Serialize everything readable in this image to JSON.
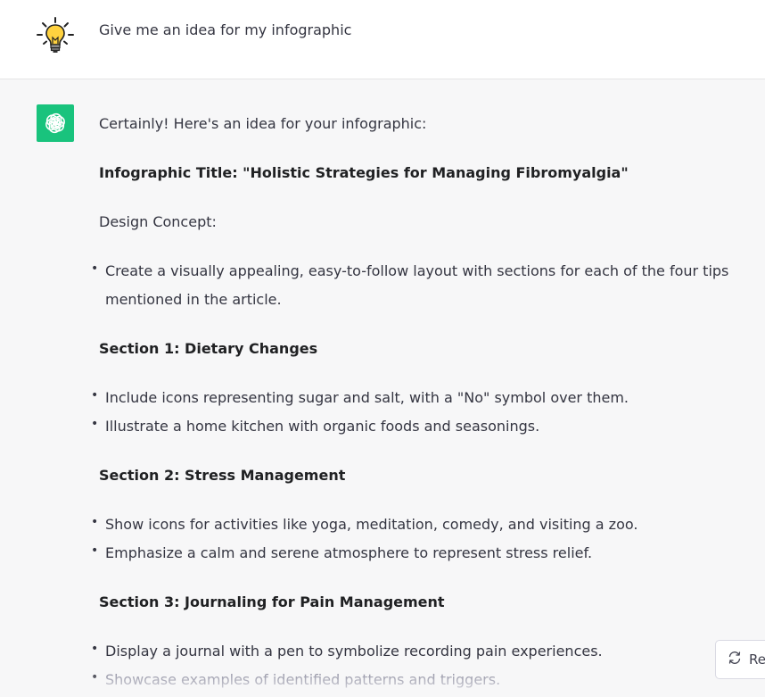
{
  "user_message": {
    "avatar_icon": "lightbulb-icon",
    "text": "Give me an idea for my infographic"
  },
  "assistant_message": {
    "avatar_icon": "openai-logo-icon",
    "avatar_color": "#19c37d",
    "intro": "Certainly! Here's an idea for your infographic:",
    "title": "Infographic Title: \"Holistic Strategies for Managing Fibromyalgia\"",
    "design_concept_label": "Design Concept:",
    "design_concept_bullets": [
      "Create a visually appealing, easy-to-follow layout with sections for each of the four tips mentioned in the article."
    ],
    "sections": [
      {
        "heading": "Section 1: Dietary Changes",
        "bullets": [
          "Include icons representing sugar and salt, with a \"No\" symbol over them.",
          "Illustrate a home kitchen with organic foods and seasonings."
        ]
      },
      {
        "heading": "Section 2: Stress Management",
        "bullets": [
          "Show icons for activities like yoga, meditation, comedy, and visiting a zoo.",
          "Emphasize a calm and serene atmosphere to represent stress relief."
        ]
      },
      {
        "heading": "Section 3: Journaling for Pain Management",
        "bullets": [
          "Display a journal with a pen to symbolize recording pain experiences.",
          "Showcase examples of identified patterns and triggers."
        ]
      }
    ]
  },
  "regenerate_button": {
    "label": "Re",
    "icon": "refresh-icon"
  }
}
